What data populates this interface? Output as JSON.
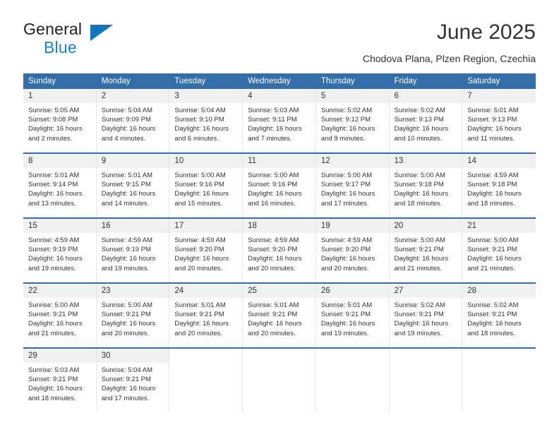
{
  "brand": {
    "name_part1": "General",
    "name_part2": "Blue",
    "accent_color": "#1883d1",
    "triangle_color": "#1175bd"
  },
  "header": {
    "title": "June 2025",
    "subtitle": "Chodova Plana, Plzen Region, Czechia"
  },
  "calendar": {
    "header_bg": "#336ea8",
    "daynum_bg": "#f1f1f1",
    "weekday_headers": [
      "Sunday",
      "Monday",
      "Tuesday",
      "Wednesday",
      "Thursday",
      "Friday",
      "Saturday"
    ],
    "weeks": [
      [
        {
          "day": "1",
          "sunrise": "Sunrise: 5:05 AM",
          "sunset": "Sunset: 9:08 PM",
          "daylight_line1": "Daylight: 16 hours",
          "daylight_line2": "and 2 minutes."
        },
        {
          "day": "2",
          "sunrise": "Sunrise: 5:04 AM",
          "sunset": "Sunset: 9:09 PM",
          "daylight_line1": "Daylight: 16 hours",
          "daylight_line2": "and 4 minutes."
        },
        {
          "day": "3",
          "sunrise": "Sunrise: 5:04 AM",
          "sunset": "Sunset: 9:10 PM",
          "daylight_line1": "Daylight: 16 hours",
          "daylight_line2": "and 6 minutes."
        },
        {
          "day": "4",
          "sunrise": "Sunrise: 5:03 AM",
          "sunset": "Sunset: 9:11 PM",
          "daylight_line1": "Daylight: 16 hours",
          "daylight_line2": "and 7 minutes."
        },
        {
          "day": "5",
          "sunrise": "Sunrise: 5:02 AM",
          "sunset": "Sunset: 9:12 PM",
          "daylight_line1": "Daylight: 16 hours",
          "daylight_line2": "and 9 minutes."
        },
        {
          "day": "6",
          "sunrise": "Sunrise: 5:02 AM",
          "sunset": "Sunset: 9:13 PM",
          "daylight_line1": "Daylight: 16 hours",
          "daylight_line2": "and 10 minutes."
        },
        {
          "day": "7",
          "sunrise": "Sunrise: 5:01 AM",
          "sunset": "Sunset: 9:13 PM",
          "daylight_line1": "Daylight: 16 hours",
          "daylight_line2": "and 11 minutes."
        }
      ],
      [
        {
          "day": "8",
          "sunrise": "Sunrise: 5:01 AM",
          "sunset": "Sunset: 9:14 PM",
          "daylight_line1": "Daylight: 16 hours",
          "daylight_line2": "and 13 minutes."
        },
        {
          "day": "9",
          "sunrise": "Sunrise: 5:01 AM",
          "sunset": "Sunset: 9:15 PM",
          "daylight_line1": "Daylight: 16 hours",
          "daylight_line2": "and 14 minutes."
        },
        {
          "day": "10",
          "sunrise": "Sunrise: 5:00 AM",
          "sunset": "Sunset: 9:16 PM",
          "daylight_line1": "Daylight: 16 hours",
          "daylight_line2": "and 15 minutes."
        },
        {
          "day": "11",
          "sunrise": "Sunrise: 5:00 AM",
          "sunset": "Sunset: 9:16 PM",
          "daylight_line1": "Daylight: 16 hours",
          "daylight_line2": "and 16 minutes."
        },
        {
          "day": "12",
          "sunrise": "Sunrise: 5:00 AM",
          "sunset": "Sunset: 9:17 PM",
          "daylight_line1": "Daylight: 16 hours",
          "daylight_line2": "and 17 minutes."
        },
        {
          "day": "13",
          "sunrise": "Sunrise: 5:00 AM",
          "sunset": "Sunset: 9:18 PM",
          "daylight_line1": "Daylight: 16 hours",
          "daylight_line2": "and 18 minutes."
        },
        {
          "day": "14",
          "sunrise": "Sunrise: 4:59 AM",
          "sunset": "Sunset: 9:18 PM",
          "daylight_line1": "Daylight: 16 hours",
          "daylight_line2": "and 18 minutes."
        }
      ],
      [
        {
          "day": "15",
          "sunrise": "Sunrise: 4:59 AM",
          "sunset": "Sunset: 9:19 PM",
          "daylight_line1": "Daylight: 16 hours",
          "daylight_line2": "and 19 minutes."
        },
        {
          "day": "16",
          "sunrise": "Sunrise: 4:59 AM",
          "sunset": "Sunset: 9:19 PM",
          "daylight_line1": "Daylight: 16 hours",
          "daylight_line2": "and 19 minutes."
        },
        {
          "day": "17",
          "sunrise": "Sunrise: 4:59 AM",
          "sunset": "Sunset: 9:20 PM",
          "daylight_line1": "Daylight: 16 hours",
          "daylight_line2": "and 20 minutes."
        },
        {
          "day": "18",
          "sunrise": "Sunrise: 4:59 AM",
          "sunset": "Sunset: 9:20 PM",
          "daylight_line1": "Daylight: 16 hours",
          "daylight_line2": "and 20 minutes."
        },
        {
          "day": "19",
          "sunrise": "Sunrise: 4:59 AM",
          "sunset": "Sunset: 9:20 PM",
          "daylight_line1": "Daylight: 16 hours",
          "daylight_line2": "and 20 minutes."
        },
        {
          "day": "20",
          "sunrise": "Sunrise: 5:00 AM",
          "sunset": "Sunset: 9:21 PM",
          "daylight_line1": "Daylight: 16 hours",
          "daylight_line2": "and 21 minutes."
        },
        {
          "day": "21",
          "sunrise": "Sunrise: 5:00 AM",
          "sunset": "Sunset: 9:21 PM",
          "daylight_line1": "Daylight: 16 hours",
          "daylight_line2": "and 21 minutes."
        }
      ],
      [
        {
          "day": "22",
          "sunrise": "Sunrise: 5:00 AM",
          "sunset": "Sunset: 9:21 PM",
          "daylight_line1": "Daylight: 16 hours",
          "daylight_line2": "and 21 minutes."
        },
        {
          "day": "23",
          "sunrise": "Sunrise: 5:00 AM",
          "sunset": "Sunset: 9:21 PM",
          "daylight_line1": "Daylight: 16 hours",
          "daylight_line2": "and 20 minutes."
        },
        {
          "day": "24",
          "sunrise": "Sunrise: 5:01 AM",
          "sunset": "Sunset: 9:21 PM",
          "daylight_line1": "Daylight: 16 hours",
          "daylight_line2": "and 20 minutes."
        },
        {
          "day": "25",
          "sunrise": "Sunrise: 5:01 AM",
          "sunset": "Sunset: 9:21 PM",
          "daylight_line1": "Daylight: 16 hours",
          "daylight_line2": "and 20 minutes."
        },
        {
          "day": "26",
          "sunrise": "Sunrise: 5:01 AM",
          "sunset": "Sunset: 9:21 PM",
          "daylight_line1": "Daylight: 16 hours",
          "daylight_line2": "and 19 minutes."
        },
        {
          "day": "27",
          "sunrise": "Sunrise: 5:02 AM",
          "sunset": "Sunset: 9:21 PM",
          "daylight_line1": "Daylight: 16 hours",
          "daylight_line2": "and 19 minutes."
        },
        {
          "day": "28",
          "sunrise": "Sunrise: 5:02 AM",
          "sunset": "Sunset: 9:21 PM",
          "daylight_line1": "Daylight: 16 hours",
          "daylight_line2": "and 18 minutes."
        }
      ],
      [
        {
          "day": "29",
          "sunrise": "Sunrise: 5:03 AM",
          "sunset": "Sunset: 9:21 PM",
          "daylight_line1": "Daylight: 16 hours",
          "daylight_line2": "and 18 minutes."
        },
        {
          "day": "30",
          "sunrise": "Sunrise: 5:04 AM",
          "sunset": "Sunset: 9:21 PM",
          "daylight_line1": "Daylight: 16 hours",
          "daylight_line2": "and 17 minutes."
        },
        {
          "day": "",
          "sunrise": "",
          "sunset": "",
          "daylight_line1": "",
          "daylight_line2": ""
        },
        {
          "day": "",
          "sunrise": "",
          "sunset": "",
          "daylight_line1": "",
          "daylight_line2": ""
        },
        {
          "day": "",
          "sunrise": "",
          "sunset": "",
          "daylight_line1": "",
          "daylight_line2": ""
        },
        {
          "day": "",
          "sunrise": "",
          "sunset": "",
          "daylight_line1": "",
          "daylight_line2": ""
        },
        {
          "day": "",
          "sunrise": "",
          "sunset": "",
          "daylight_line1": "",
          "daylight_line2": ""
        }
      ]
    ]
  }
}
